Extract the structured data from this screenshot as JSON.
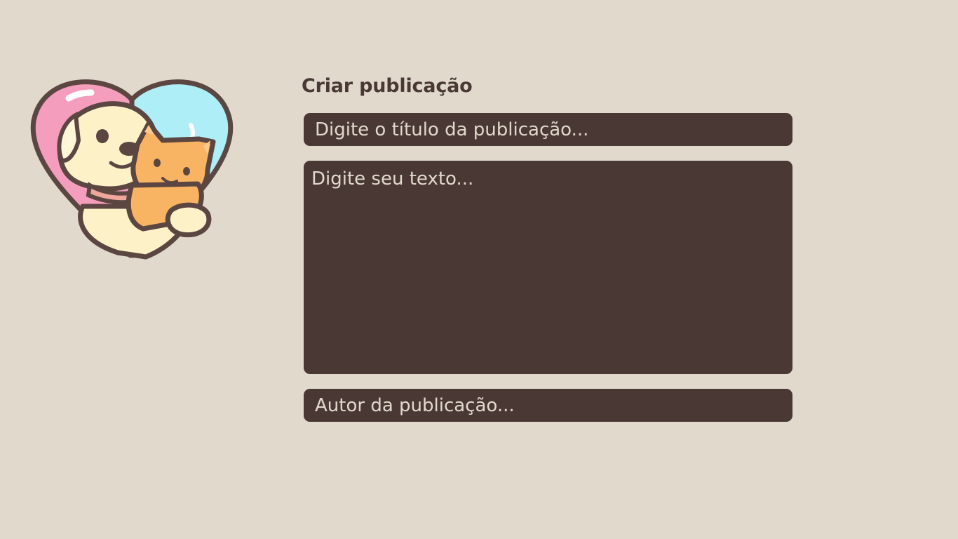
{
  "logo": {
    "icon": "dog-and-cat-heart-icon",
    "colors": {
      "heart_left": "#f59dbc",
      "heart_right": "#aeeef7",
      "dog": "#fdf1c8",
      "cat": "#f9b463",
      "outline": "#5b4641",
      "collar": "#eea79b"
    }
  },
  "form": {
    "heading": "Criar publicação",
    "title_field": {
      "placeholder": "Digite o título da publicação...",
      "value": ""
    },
    "body_field": {
      "placeholder": "Digite seu texto...",
      "value": ""
    },
    "author_field": {
      "placeholder": "Autor da publicação...",
      "value": ""
    }
  },
  "theme": {
    "background": "#e0d9cc",
    "field_background": "#4a3835",
    "field_text": "#e8e1d6",
    "heading_color": "#4a3835"
  }
}
